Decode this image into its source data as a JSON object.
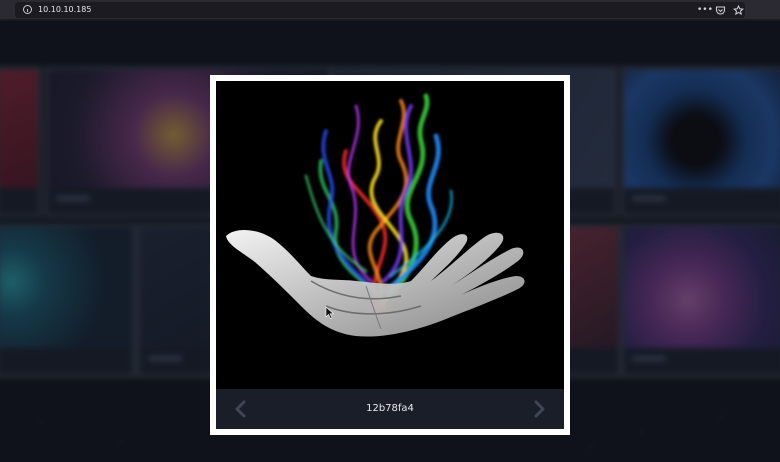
{
  "browser": {
    "url": "10.10.10.185",
    "icons": [
      "info-icon",
      "more-icon",
      "pocket-icon",
      "bookmark-star-icon"
    ]
  },
  "lightbox": {
    "caption": "12b78fa4",
    "prev_icon": "chevron-left-icon",
    "next_icon": "chevron-right-icon"
  },
  "colors": {
    "page_bg": "#141923",
    "lightbox_frame": "#ffffff",
    "caption_bar": "#1a1e28",
    "arrow": "#3f4656"
  }
}
